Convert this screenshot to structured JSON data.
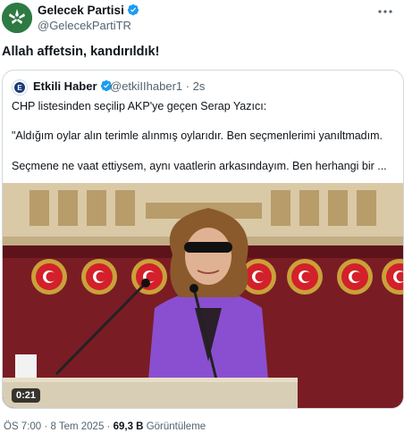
{
  "author": {
    "name": "Gelecek Partisi",
    "handle": "@GelecekPartiTR",
    "avatar_color": "#2d7a43"
  },
  "tweet": {
    "text": "Allah affetsin, kandırıldık!"
  },
  "quoted": {
    "name": "Etkili Haber",
    "handle": "@etkiIIhaber1 · 2s",
    "lines": [
      "CHP listesinden seçilip AKP'ye geçen Serap Yazıcı:",
      "\"Aldığım oylar alın terimle alınmış oylarıdır. Ben seçmenlerimi yanıltmadım.",
      "Seçmene ne vaat ettiysem, aynı vaatlerin arkasındayım. Ben herhangi bir ..."
    ],
    "video_duration": "0:21"
  },
  "meta": {
    "time": "ÖS 7:00",
    "separator": "·",
    "date": "8 Tem 2025",
    "views_count": "69,3 B",
    "views_label": "Görüntüleme"
  },
  "colors": {
    "verified": "#1d9bf0",
    "muted_text": "#536471",
    "backdrop_red": "#7a1c24",
    "jacket_purple": "#8a4fd0"
  }
}
